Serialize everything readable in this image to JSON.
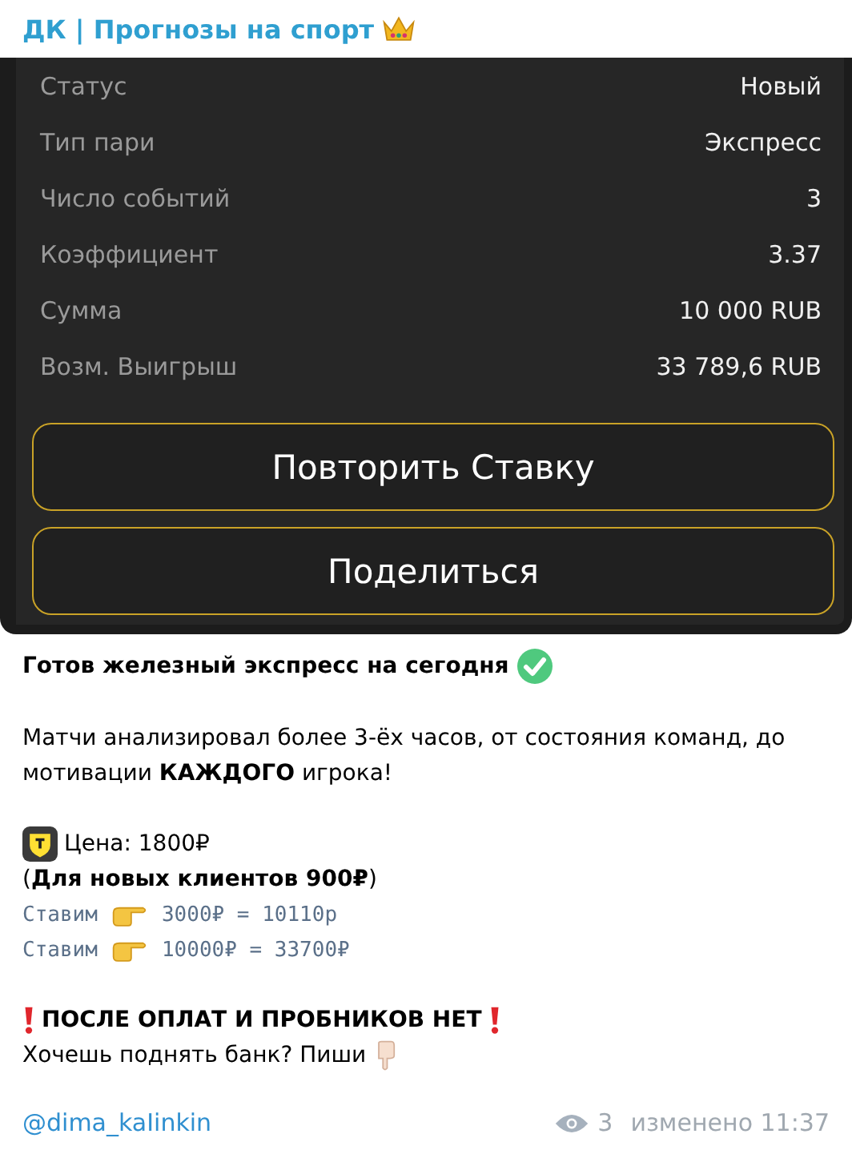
{
  "channel": {
    "title": "ДК | Прогнозы на спорт"
  },
  "bet_slip": {
    "rows": [
      {
        "label": "Статус",
        "value": "Новый"
      },
      {
        "label": "Тип пари",
        "value": "Экспресс"
      },
      {
        "label": "Число событий",
        "value": "3"
      },
      {
        "label": "Коэффициент",
        "value": "3.37"
      },
      {
        "label": "Сумма",
        "value": "10 000 RUB"
      },
      {
        "label": "Возм. Выигрыш",
        "value": "33 789,6 RUB"
      }
    ],
    "buttons": [
      "Повторить Ставку",
      "Поделиться"
    ]
  },
  "message": {
    "headline": "Готов железный экспресс на сегодня",
    "body": "Матчи анализировал более 3-ёх часов, от состояния команд, до мотивации **КАЖДОГО** игрока!",
    "price": "Цена: 1800₽",
    "offer": "(**Для новых клиентов 900₽**)",
    "stakes": [
      {
        "label": "Ставим",
        "amount": "3000₽ = 10110р"
      },
      {
        "label": "Ставим",
        "amount": "10000₽ = 33700₽"
      }
    ],
    "warning": "ПОСЛЕ ОПЛАТ И ПРОБНИКОВ НЕТ",
    "call": "Хочешь поднять банк? Пиши",
    "link": "@dima_kaIinkin",
    "views": "3",
    "edited": "изменено 11:37"
  }
}
